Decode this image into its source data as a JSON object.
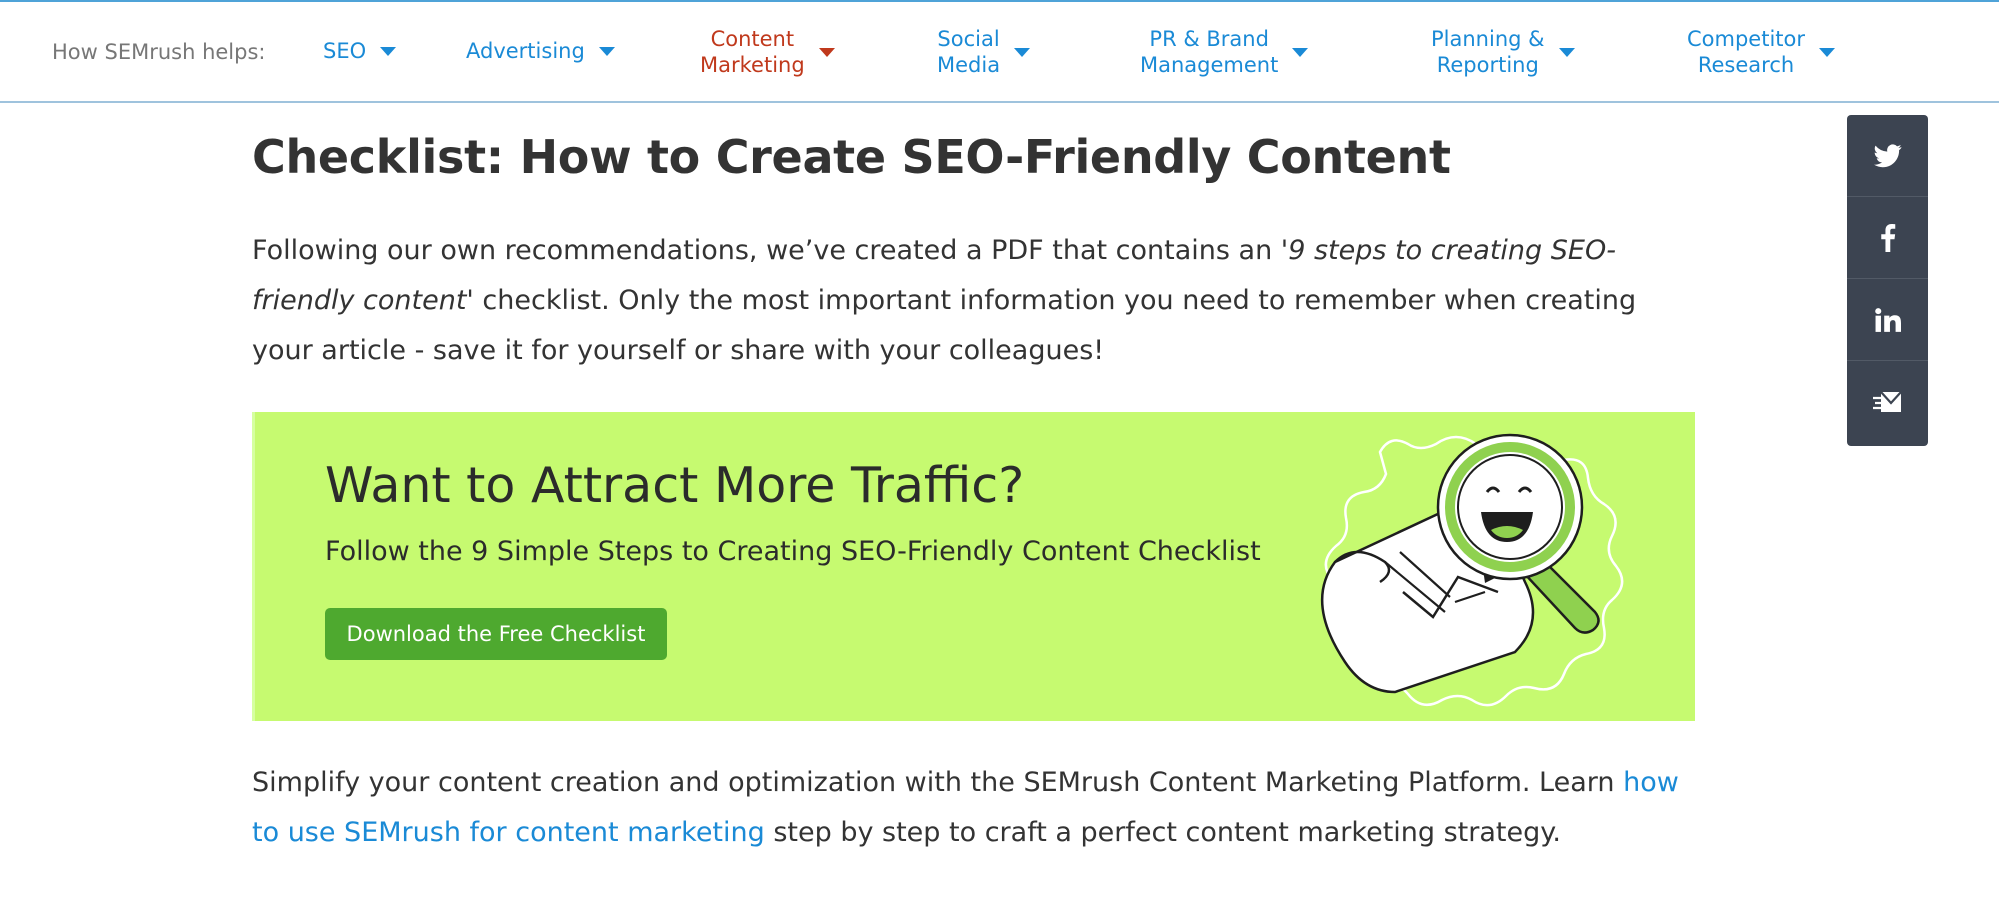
{
  "nav": {
    "lead": "How SEMrush helps:",
    "items": [
      {
        "label": "SEO",
        "active": false
      },
      {
        "label": "Advertising",
        "active": false
      },
      {
        "label": "Content\nMarketing",
        "active": true
      },
      {
        "label": "Social\nMedia",
        "active": false
      },
      {
        "label": "PR & Brand\nManagement",
        "active": false
      },
      {
        "label": "Planning &\nReporting",
        "active": false
      },
      {
        "label": "Competitor\nResearch",
        "active": false
      }
    ]
  },
  "article": {
    "title": "Checklist: How to Create SEO-Friendly Content",
    "intro_1": "Following our own recommendations, we’ve created a PDF that contains an '",
    "intro_em": "9 steps to creating SEO-friendly content",
    "intro_2": "' checklist. Only the most important information you need to remember when creating your article - save it for yourself or share with your colleagues!",
    "outro_1": "Simplify your content creation and optimization with the SEMrush Content Marketing Platform. Learn ",
    "outro_link": "how to use SEMrush for content marketing",
    "outro_2": " step by step to craft a perfect content marketing strategy."
  },
  "banner": {
    "title": "Want to Attract More Traffic?",
    "subtitle": "Follow the 9 Simple Steps to Creating SEO-Friendly Content Checklist",
    "button": "Download the Free Checklist",
    "background_color": "#c6fa70",
    "button_color": "#4ea92f"
  },
  "share": {
    "buttons": [
      "twitter-icon",
      "facebook-icon",
      "linkedin-icon",
      "email-icon"
    ]
  },
  "colors": {
    "link": "#1a8ad6",
    "active_nav": "#c0391c",
    "share_bar": "#3c4451"
  }
}
